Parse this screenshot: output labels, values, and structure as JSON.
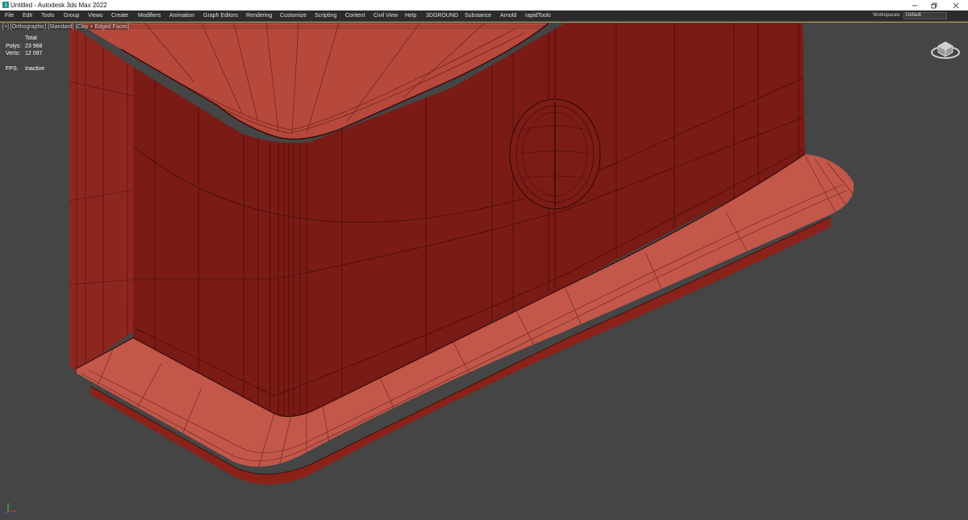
{
  "window": {
    "title": "Untitled - Autodesk 3ds Max 2022",
    "controls": [
      "minimize",
      "restore",
      "close"
    ]
  },
  "menubar": {
    "items": [
      "File",
      "Edit",
      "Tools",
      "Group",
      "Views",
      "Create",
      "Modifiers",
      "Animation",
      "Graph Editors",
      "Rendering",
      "Customize",
      "Scripting",
      "Content",
      "Civil View",
      "Help",
      "3DGROUND",
      "Substance",
      "Arnold",
      "rapidTools"
    ],
    "workspaces_label": "Workspaces:",
    "workspace_value": "Default"
  },
  "viewport": {
    "label": "[+] [Orthographic] [Standard] [Clay + Edged Faces]",
    "stats": {
      "header": "Total",
      "polys_label": "Polys:",
      "polys_value": "23 968",
      "verts_label": "Verts:",
      "verts_value": "12 097",
      "fps_label": "FPS:",
      "fps_value": "Inactive"
    },
    "model_color": "#9b2a22",
    "background_color": "#454545",
    "icons": [
      "viewcube-icon",
      "axis-tripod-icon"
    ]
  }
}
